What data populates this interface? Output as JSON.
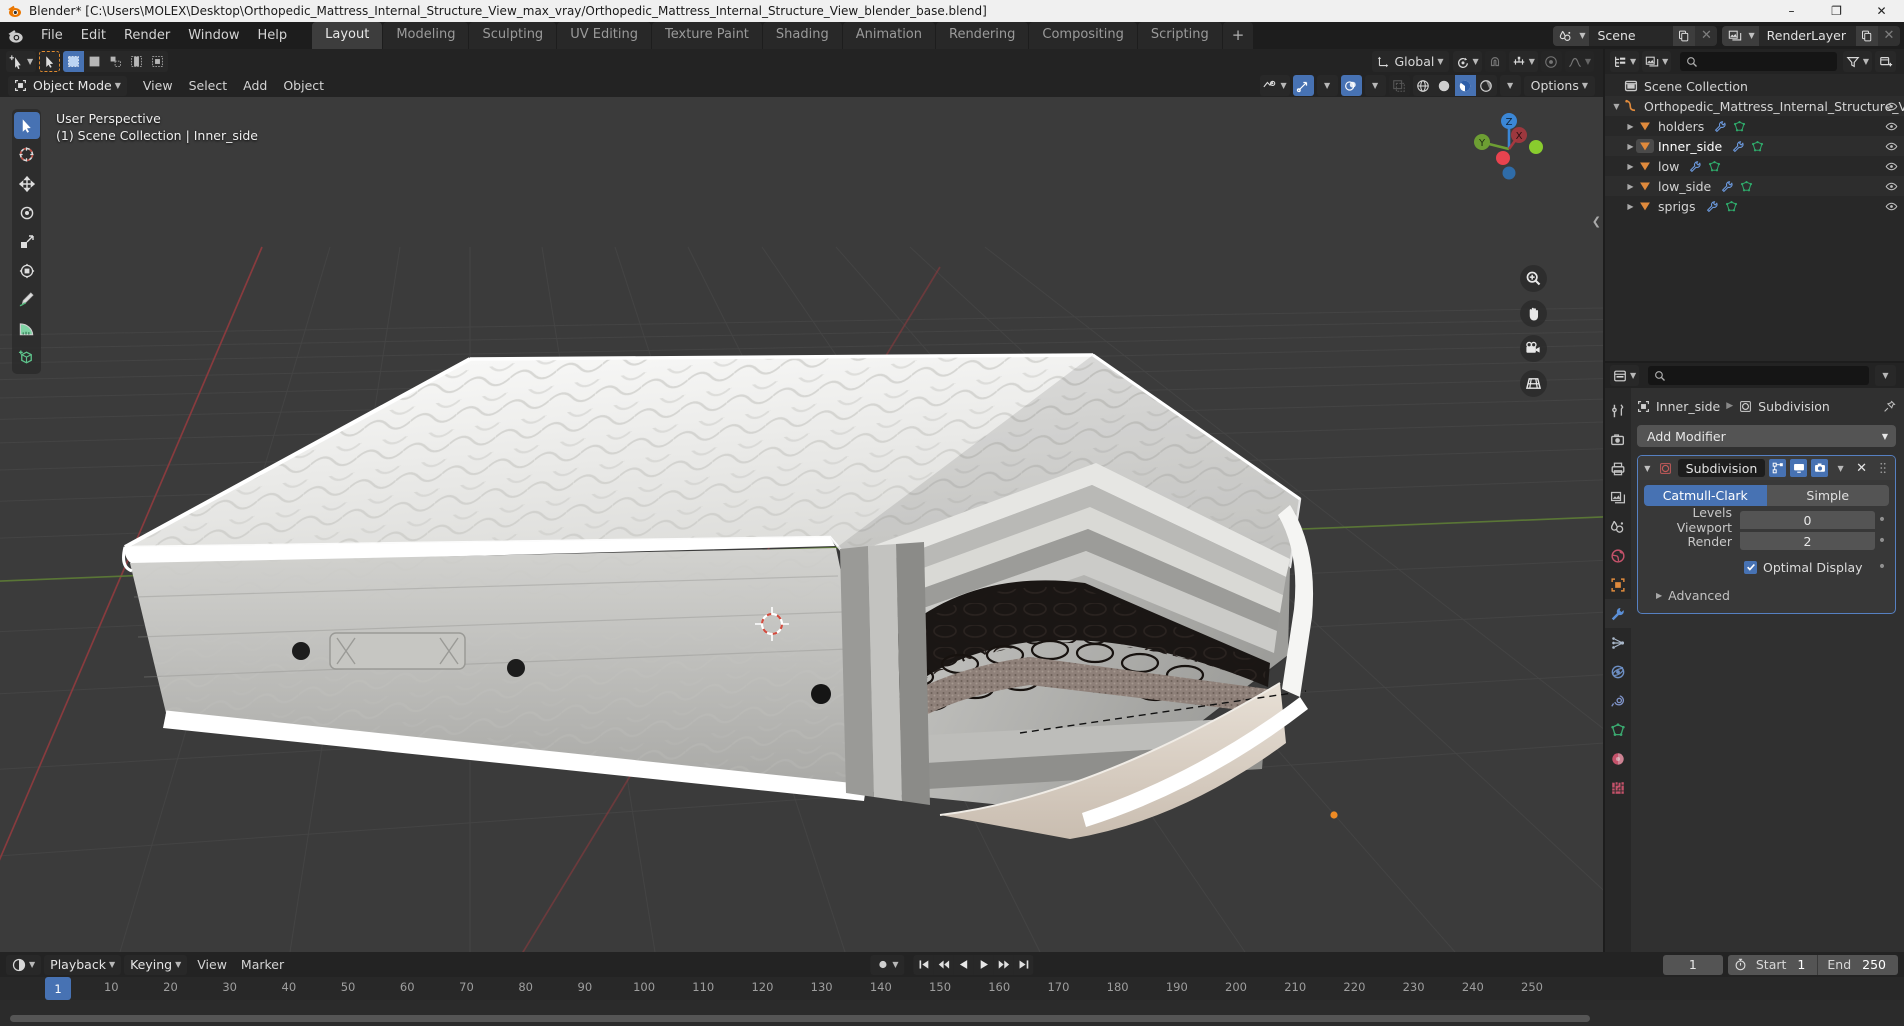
{
  "window": {
    "title": "Blender* [C:\\Users\\MOLEX\\Desktop\\Orthopedic_Mattress_Internal_Structure_View_max_vray/Orthopedic_Mattress_Internal_Structure_View_blender_base.blend]",
    "minimize": "–",
    "maximize": "❐",
    "close": "✕"
  },
  "topbar": {
    "menus": [
      "File",
      "Edit",
      "Render",
      "Window",
      "Help"
    ],
    "workspaces": [
      {
        "label": "Layout",
        "active": true
      },
      {
        "label": "Modeling",
        "active": false
      },
      {
        "label": "Sculpting",
        "active": false
      },
      {
        "label": "UV Editing",
        "active": false
      },
      {
        "label": "Texture Paint",
        "active": false
      },
      {
        "label": "Shading",
        "active": false
      },
      {
        "label": "Animation",
        "active": false
      },
      {
        "label": "Rendering",
        "active": false
      },
      {
        "label": "Compositing",
        "active": false
      },
      {
        "label": "Scripting",
        "active": false
      }
    ],
    "add_workspace": "+",
    "scene_name": "Scene",
    "viewlayer_name": "RenderLayer"
  },
  "viewport_header": {
    "transform_orientation": "Global",
    "options_label": "Options"
  },
  "viewport_header2": {
    "mode": "Object Mode",
    "menus": [
      "View",
      "Select",
      "Add",
      "Object"
    ]
  },
  "viewport": {
    "overlay_line1": "User Perspective",
    "overlay_line2": "(1) Scene Collection | Inner_side",
    "gizmo_axes": {
      "x": "X",
      "y": "Y",
      "z": "Z"
    },
    "colors": {
      "background": "#3b3b3b",
      "grid": "#4a4a4a",
      "axis_x": "#a33b3b",
      "axis_y": "#5a8a3b",
      "gizmo_x": "#cc4d55",
      "gizmo_y": "#87c433",
      "gizmo_z": "#3b87d6",
      "accent": "#4772b3",
      "active_object_outline": "#ffa028"
    }
  },
  "outliner": {
    "root": "Scene Collection",
    "items": [
      {
        "label": "Orthopedic_Mattress_Internal_Structure_Vie",
        "indent": 0,
        "icon": "armature-icon",
        "expanded": true,
        "selected": false,
        "mods": []
      },
      {
        "label": "holders",
        "indent": 1,
        "icon": "mesh-tri-icon",
        "expanded": false,
        "selected": false,
        "mods": [
          "wrench-icon",
          "mesh-data-icon"
        ]
      },
      {
        "label": "Inner_side",
        "indent": 1,
        "icon": "mesh-tri-icon",
        "expanded": false,
        "selected": true,
        "mods": [
          "wrench-icon",
          "mesh-data-icon"
        ]
      },
      {
        "label": "low",
        "indent": 1,
        "icon": "mesh-tri-icon",
        "expanded": false,
        "selected": false,
        "mods": [
          "wrench-icon",
          "mesh-data-icon"
        ]
      },
      {
        "label": "low_side",
        "indent": 1,
        "icon": "mesh-tri-icon",
        "expanded": false,
        "selected": false,
        "mods": [
          "wrench-icon",
          "mesh-data-icon"
        ]
      },
      {
        "label": "sprigs",
        "indent": 1,
        "icon": "mesh-tri-icon",
        "expanded": false,
        "selected": false,
        "mods": [
          "wrench-icon",
          "mesh-data-icon"
        ]
      }
    ]
  },
  "properties": {
    "breadcrumb_object": "Inner_side",
    "breadcrumb_modifier": "Subdivision",
    "add_modifier_label": "Add Modifier",
    "modifier": {
      "name": "Subdivision",
      "type_options": [
        {
          "label": "Catmull-Clark",
          "active": true
        },
        {
          "label": "Simple",
          "active": false
        }
      ],
      "levels_viewport_label": "Levels Viewport",
      "levels_viewport_value": "0",
      "render_label": "Render",
      "render_value": "2",
      "optimal_display_label": "Optimal Display",
      "optimal_display_checked": true,
      "advanced_label": "Advanced"
    }
  },
  "timeline": {
    "menus": [
      "View",
      "Marker"
    ],
    "playback_label": "Playback",
    "keying_label": "Keying",
    "current_frame": "1",
    "start_label": "Start",
    "start_value": "1",
    "end_label": "End",
    "end_value": "250",
    "ruler_ticks": [
      "10",
      "20",
      "30",
      "40",
      "50",
      "60",
      "70",
      "80",
      "90",
      "100",
      "110",
      "120",
      "130",
      "140",
      "150",
      "160",
      "170",
      "180",
      "190",
      "200",
      "210",
      "220",
      "230",
      "240",
      "250"
    ],
    "playhead_frame": "1"
  }
}
